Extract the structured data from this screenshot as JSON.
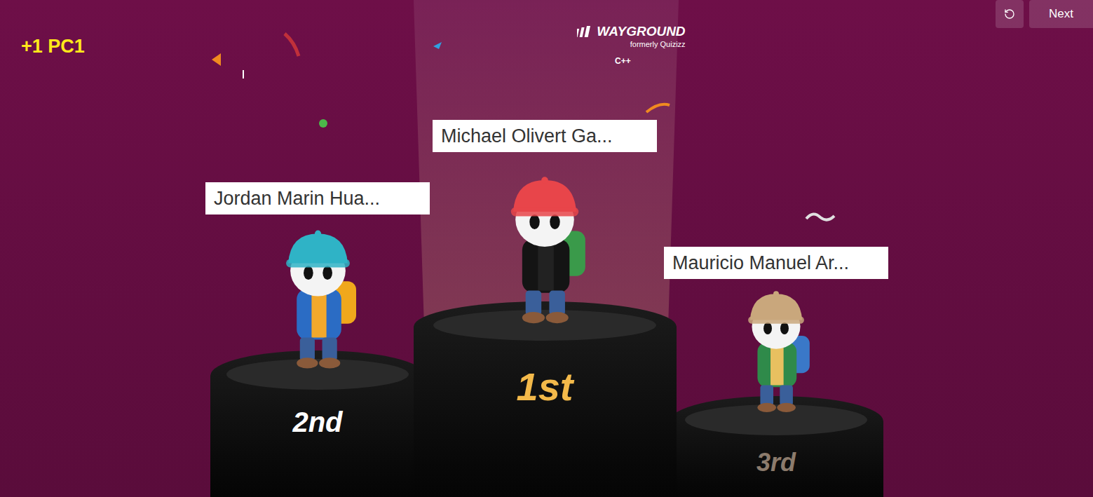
{
  "corner_label": "+1 PC1",
  "logo": {
    "name": "WAYGROUND",
    "subtitle": "formerly Quizizz"
  },
  "quiz_title": "C++",
  "buttons": [
    {
      "label": "Next"
    }
  ],
  "podium": [
    {
      "name": "Jordan Marin Hua...",
      "rank": "2nd",
      "spotlight": false,
      "color": "#2fb3c6"
    },
    {
      "name": "Michael Olivert Ga...",
      "rank": "1st",
      "spotlight": true,
      "color": "#e8454a"
    },
    {
      "name": "Mauricio Manuel Ar...",
      "rank": "3rd",
      "spotlight": false,
      "color": "#c9a77c"
    }
  ]
}
